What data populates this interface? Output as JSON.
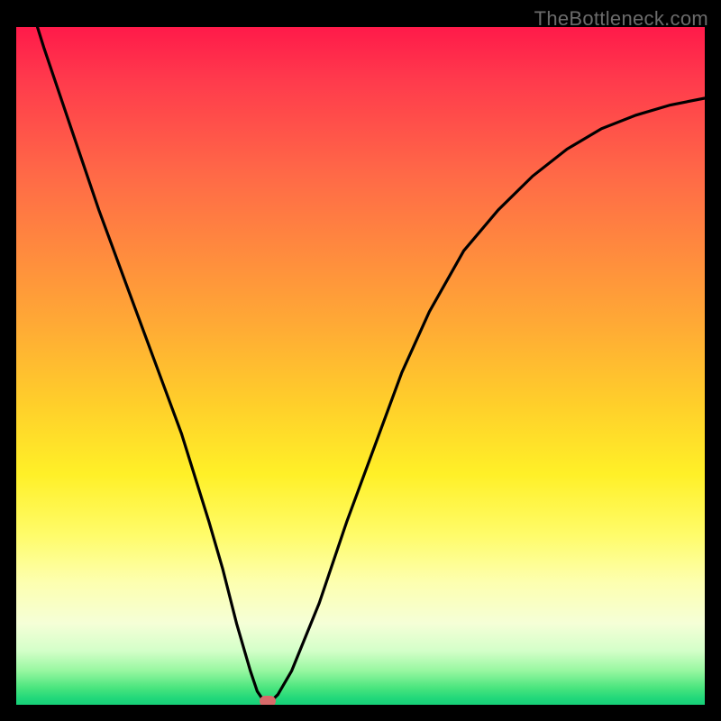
{
  "watermark": "TheBottleneck.com",
  "colors": {
    "frame_bg": "#000000",
    "curve_stroke": "#000000",
    "marker_fill": "#d86a6a",
    "gradient_top": "#ff1a4a",
    "gradient_bottom": "#16cf78"
  },
  "chart_data": {
    "type": "line",
    "title": "",
    "xlabel": "",
    "ylabel": "",
    "xlim": [
      0,
      100
    ],
    "ylim": [
      0,
      100
    ],
    "grid": false,
    "legend": false,
    "series": [
      {
        "name": "bottleneck-curve",
        "x": [
          0,
          4,
          8,
          12,
          16,
          20,
          24,
          28,
          30,
          32,
          34,
          35,
          36,
          37,
          38,
          40,
          44,
          48,
          52,
          56,
          60,
          65,
          70,
          75,
          80,
          85,
          90,
          95,
          100
        ],
        "y": [
          110,
          97,
          85,
          73,
          62,
          51,
          40,
          27,
          20,
          12,
          5,
          2,
          0.5,
          0.5,
          1.5,
          5,
          15,
          27,
          38,
          49,
          58,
          67,
          73,
          78,
          82,
          85,
          87,
          88.5,
          89.5
        ]
      }
    ],
    "marker": {
      "x": 36.5,
      "y": 0.5
    },
    "color_bands_meaning": "green=good, yellow=ok, red=bottleneck"
  }
}
